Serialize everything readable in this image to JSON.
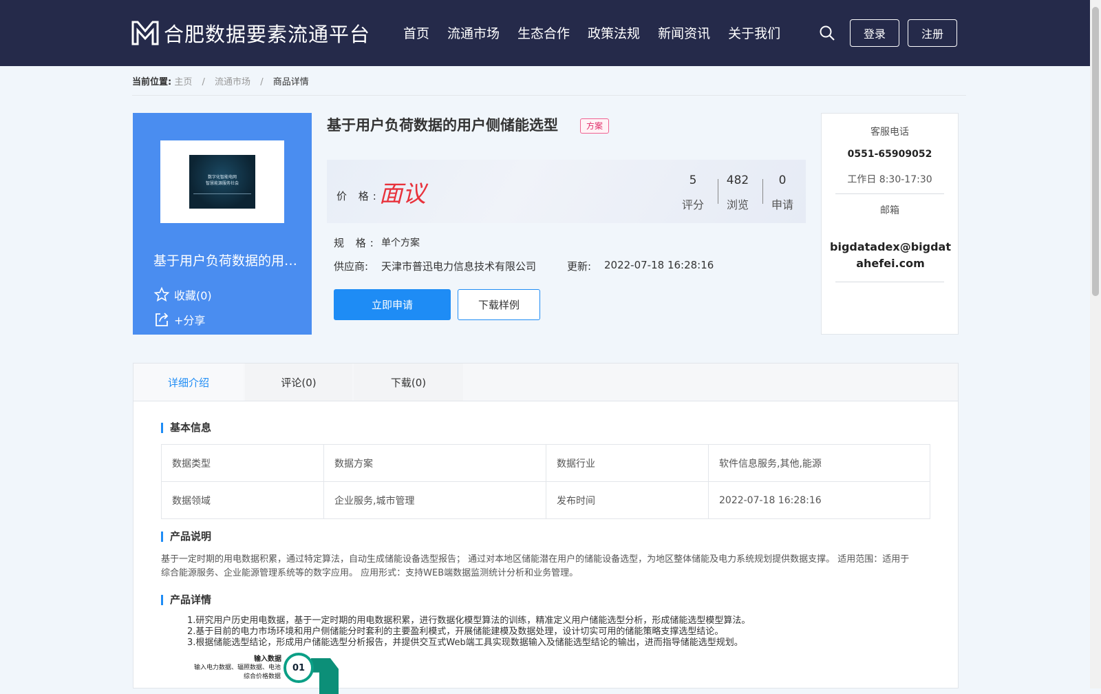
{
  "header": {
    "site_name": "合肥数据要素流通平台",
    "nav": [
      "首页",
      "流通市场",
      "生态合作",
      "政策法规",
      "新闻资讯",
      "关于我们"
    ],
    "login_label": "登录",
    "register_label": "注册"
  },
  "breadcrumb": {
    "label": "当前位置:",
    "items": [
      "主页",
      "流通市场",
      "商品详情"
    ],
    "separator": "/"
  },
  "card": {
    "thumb_text": "数字化智能电网\n智慧能源服务社会",
    "title": "基于用户负荷数据的用户侧储能选型",
    "favorite": "收藏(0)",
    "share": "+分享"
  },
  "product": {
    "title": "基于用户负荷数据的用户侧储能选型",
    "tag": "方案",
    "price_label": "价 格:",
    "price_value": "面议",
    "stats": [
      {
        "num": "5",
        "label": "评分"
      },
      {
        "num": "482",
        "label": "浏览"
      },
      {
        "num": "0",
        "label": "申请"
      }
    ],
    "spec_label": "规 格:",
    "spec_value": "单个方案",
    "supplier_label": "供应商:",
    "supplier_value": "天津市普迅电力信息技术有限公司",
    "update_label": "更新:",
    "update_value": "2022-07-18 16:28:16",
    "apply_label": "立即申请",
    "sample_label": "下载样例"
  },
  "contact": {
    "phone_title": "客服电话",
    "phone": "0551-65909052",
    "hours": "工作日 8:30-17:30",
    "email_title": "邮箱",
    "email": "bigdatadex@bigdatahefei.com"
  },
  "tabs": [
    "详细介绍",
    "评论(0)",
    "下载(0)"
  ],
  "basic_info": {
    "title": "基本信息",
    "rows": [
      [
        "数据类型",
        "数据方案",
        "数据行业",
        "软件信息服务,其他,能源"
      ],
      [
        "数据领域",
        "企业服务,城市管理",
        "发布时间",
        "2022-07-18 16:28:16"
      ]
    ]
  },
  "description": {
    "title": "产品说明",
    "text": "基于一定时期的用电数据积累，通过特定算法，自动生成储能设备选型报告； 通过对本地区储能潜在用户的储能设备选型，为地区整体储能及电力系统规划提供数据支撑。 适用范围：适用于综合能源服务、企业能源管理系统等的数字应用。 应用形式：支持WEB端数据监测统计分析和业务管理。"
  },
  "details": {
    "title": "产品详情",
    "lines": [
      "1.研究用户历史用电数据，基于一定时期的用电数据积累，进行数据化模型算法的训练，精准定义用户储能选型分析，形成储能选型模型算法。",
      "2.基于目前的电力市场环境和用户侧储能分时套利的主要盈利模式，开展储能建模及数据处理，设计切实可用的储能策略支撑选型结论。",
      "3.根据储能选型结论，形成用户储能选型分析报告，并提供交互式Web端工具实现数据输入及储能选型结论的输出，进而指导储能选型规划。"
    ],
    "illus_title": "输入数据",
    "illus_text": "输入电力数据、辐照数据、电池\n综合价格数据",
    "illus_step": "01"
  }
}
